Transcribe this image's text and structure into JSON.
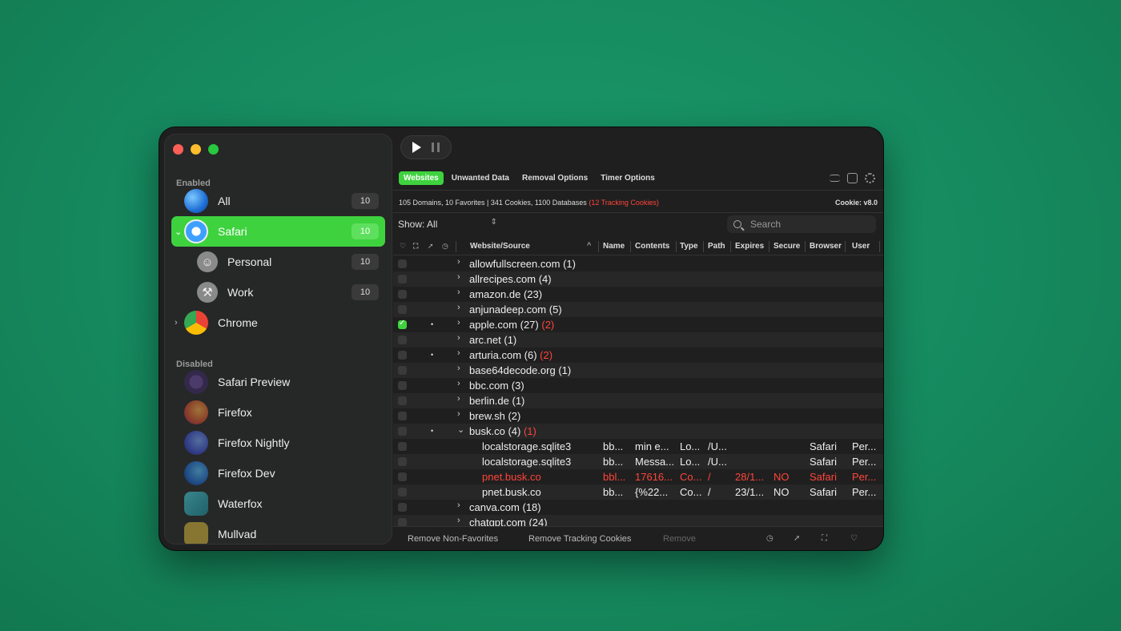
{
  "sidebar": {
    "enabled_label": "Enabled",
    "disabled_label": "Disabled",
    "enabled": [
      {
        "label": "All",
        "count": "10",
        "icon": "globe-icon",
        "chevron": ""
      },
      {
        "label": "Safari",
        "count": "10",
        "icon": "safari-icon",
        "chevron": "⌄"
      },
      {
        "label": "Personal",
        "count": "10",
        "icon": "smiley-profile-icon",
        "chevron": ""
      },
      {
        "label": "Work",
        "count": "10",
        "icon": "hammer-profile-icon",
        "chevron": ""
      },
      {
        "label": "Chrome",
        "count": "",
        "icon": "chrome-icon",
        "chevron": "›"
      }
    ],
    "disabled": [
      {
        "label": "Safari Preview",
        "icon": "safari-preview-icon"
      },
      {
        "label": "Firefox",
        "icon": "firefox-icon"
      },
      {
        "label": "Firefox Nightly",
        "icon": "firefox-nightly-icon"
      },
      {
        "label": "Firefox Dev",
        "icon": "firefox-dev-icon"
      },
      {
        "label": "Waterfox",
        "icon": "waterfox-icon"
      },
      {
        "label": "Mullvad",
        "icon": "mullvad-icon"
      }
    ]
  },
  "toolbar": {
    "tabs": [
      "Websites",
      "Unwanted Data",
      "Removal Options",
      "Timer Options"
    ],
    "active_tab": "Websites"
  },
  "stats": {
    "summary": "105 Domains, 10 Favorites | 341 Cookies, 1100 Databases",
    "tracking": "(12 Tracking Cookies)",
    "version": "Cookie: v8.0"
  },
  "filter": {
    "show_label": "Show: All",
    "search_placeholder": "Search"
  },
  "columns": [
    "Website/Source",
    "Name",
    "Contents",
    "Type",
    "Path",
    "Expires",
    "Secure",
    "Browser",
    "User"
  ],
  "rows": [
    {
      "site": "allowfullscreen.com",
      "count": "(1)",
      "tracking": "",
      "checked": false,
      "dot": false,
      "expanded": false
    },
    {
      "site": "allrecipes.com",
      "count": "(4)",
      "tracking": "",
      "checked": false,
      "dot": false,
      "expanded": false
    },
    {
      "site": "amazon.de",
      "count": "(23)",
      "tracking": "",
      "checked": false,
      "dot": false,
      "expanded": false
    },
    {
      "site": "anjunadeep.com",
      "count": "(5)",
      "tracking": "",
      "checked": false,
      "dot": false,
      "expanded": false
    },
    {
      "site": "apple.com",
      "count": "(27)",
      "tracking": "(2)",
      "checked": true,
      "dot": true,
      "expanded": false
    },
    {
      "site": "arc.net",
      "count": "(1)",
      "tracking": "",
      "checked": false,
      "dot": false,
      "expanded": false
    },
    {
      "site": "arturia.com",
      "count": "(6)",
      "tracking": "(2)",
      "checked": false,
      "dot": true,
      "expanded": false
    },
    {
      "site": "base64decode.org",
      "count": "(1)",
      "tracking": "",
      "checked": false,
      "dot": false,
      "expanded": false
    },
    {
      "site": "bbc.com",
      "count": "(3)",
      "tracking": "",
      "checked": false,
      "dot": false,
      "expanded": false
    },
    {
      "site": "berlin.de",
      "count": "(1)",
      "tracking": "",
      "checked": false,
      "dot": false,
      "expanded": false
    },
    {
      "site": "brew.sh",
      "count": "(2)",
      "tracking": "",
      "checked": false,
      "dot": false,
      "expanded": false
    },
    {
      "site": "busk.co",
      "count": "(4)",
      "tracking": "(1)",
      "checked": false,
      "dot": true,
      "expanded": true
    },
    {
      "child": true,
      "site": "localstorage.sqlite3",
      "name": "bb...",
      "contents": "min e...",
      "type": "Lo...",
      "path": "/U...",
      "expires": "",
      "secure": "",
      "browser": "Safari",
      "user": "Per...",
      "tracked": false
    },
    {
      "child": true,
      "site": "localstorage.sqlite3",
      "name": "bb...",
      "contents": "Messa...",
      "type": "Lo...",
      "path": "/U...",
      "expires": "",
      "secure": "",
      "browser": "Safari",
      "user": "Per...",
      "tracked": false
    },
    {
      "child": true,
      "site": "pnet.busk.co",
      "name": "bbl...",
      "contents": "17616...",
      "type": "Co...",
      "path": "/",
      "expires": "28/1...",
      "secure": "NO",
      "browser": "Safari",
      "user": "Per...",
      "tracked": true
    },
    {
      "child": true,
      "site": "pnet.busk.co",
      "name": "bb...",
      "contents": "{%22...",
      "type": "Co...",
      "path": "/",
      "expires": "23/1...",
      "secure": "NO",
      "browser": "Safari",
      "user": "Per...",
      "tracked": false
    },
    {
      "site": "canva.com",
      "count": "(18)",
      "tracking": "",
      "checked": false,
      "dot": false,
      "expanded": false
    },
    {
      "site": "chatgpt.com",
      "count": "(24)",
      "tracking": "",
      "checked": false,
      "dot": false,
      "expanded": false
    }
  ],
  "footer": {
    "remove_non_favorites": "Remove Non-Favorites",
    "remove_tracking": "Remove Tracking Cookies",
    "remove": "Remove"
  },
  "colors": {
    "accent": "#3fd23f",
    "tracking": "#ff453a",
    "background": "#168a5f"
  }
}
